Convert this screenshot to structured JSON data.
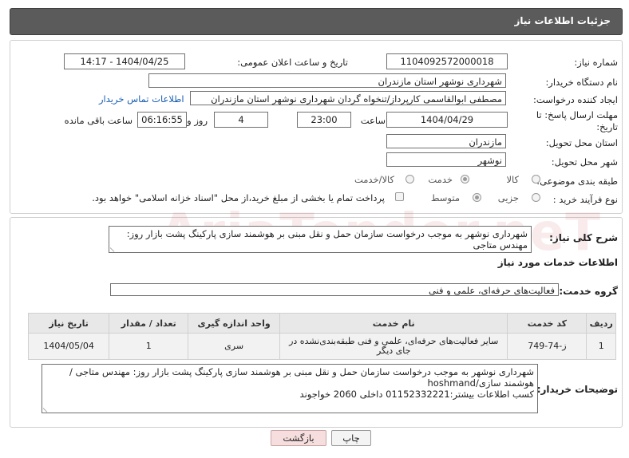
{
  "header": {
    "title": "جزئیات اطلاعات نیاز"
  },
  "fields": {
    "need_number_label": "شماره نیاز:",
    "need_number": "1104092572000018",
    "announce_label": "تاریخ و ساعت اعلان عمومی:",
    "announce_value": "1404/04/25 - 14:17",
    "buyer_org_label": "نام دستگاه خریدار:",
    "buyer_org": "شهرداری نوشهر استان مازندران",
    "creator_label": "ایجاد کننده درخواست:",
    "creator": "مصطفی  ابوالقاسمی کارپرداز/تنخواه گردان شهرداری نوشهر استان مازندران",
    "contact_link": "اطلاعات تماس خریدار",
    "deadline_label_1": "مهلت ارسال پاسخ: تا",
    "deadline_label_2": "تاریخ:",
    "deadline_date": "1404/04/29",
    "time_label": "ساعت",
    "deadline_time": "23:00",
    "days_value": "4",
    "days_label": "روز و",
    "remaining_time": "06:16:55",
    "remaining_label": "ساعت باقی مانده",
    "province_label": "استان محل تحویل:",
    "province": "مازندران",
    "city_label": "شهر محل تحویل:",
    "city": "نوشهر",
    "category_label": "طبقه بندی موضوعی:",
    "category_options": [
      "کالا",
      "خدمت",
      "کالا/خدمت"
    ],
    "process_label": "نوع فرآیند خرید :",
    "process_options": [
      "جزیی",
      "متوسط"
    ],
    "payment_note": "پرداخت تمام یا بخشی از مبلغ خرید،از محل \"اسناد خزانه اسلامی\" خواهد بود."
  },
  "summary": {
    "label": "شرح کلی نیاز:",
    "text": "شهرداری نوشهر به موجب درخواست سازمان حمل و نقل مبنی بر هوشمند سازی پارکینگ پشت بازار روز: مهندس متاجی"
  },
  "services": {
    "title": "اطلاعات خدمات مورد نیاز",
    "group_label": "گروه خدمت:",
    "group_value": "فعالیت‌های حرفه‌ای، علمی و فنی",
    "columns": [
      "ردیف",
      "کد خدمت",
      "نام خدمت",
      "واحد اندازه گیری",
      "تعداد / مقدار",
      "تاریخ نیاز"
    ],
    "rows": [
      [
        "1",
        "ز-74-749",
        "سایر فعالیت‌های حرفه‌ای، علمی و فنی طبقه‌بندی‌نشده در جای دیگر",
        "سری",
        "1",
        "1404/05/04"
      ]
    ]
  },
  "buyer_notes": {
    "label": "توضیحات خریدار:",
    "line1": "شهرداری نوشهر به موجب درخواست سازمان حمل و نقل مبنی بر هوشمند سازی پارکینگ پشت بازار روز: مهندس متاجی /",
    "line2": "هوشمند سازی/hoshmand",
    "line3": "کسب اطلاعات بیشتر:01152332221 داخلی 2060 خواجوند"
  },
  "buttons": {
    "print": "چاپ",
    "back": "بازگشت"
  },
  "watermark": "AriaTender.neT",
  "colors": {
    "header_bg": "#5b5b5b",
    "link": "#1a5fb4",
    "back_button": "#f7dede"
  }
}
